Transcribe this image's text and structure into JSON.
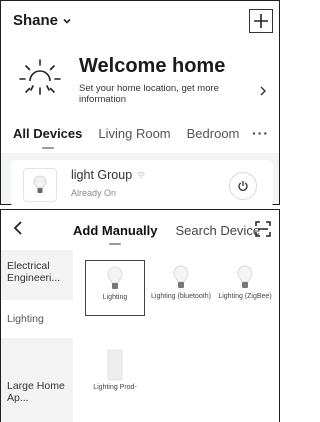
{
  "top": {
    "home_name": "Shane",
    "welcome_title": "Welcome home",
    "welcome_subtitle": "Set your home location, get more information",
    "rooms": [
      "All Devices",
      "Living Room",
      "Bedroom"
    ],
    "more_label": "···",
    "device": {
      "name": "light Group",
      "status": "Already On"
    }
  },
  "bottom": {
    "tabs": [
      "Add Manually",
      "Search Device"
    ],
    "categories": [
      "Electrical Engineeri...",
      "Lighting",
      "Large Home Ap..."
    ],
    "products": [
      {
        "label": "Lighting"
      },
      {
        "label": "Lighting (bluetooth)"
      },
      {
        "label": "Lighting (ZigBee)"
      },
      {
        "label": "Lighting Prod-"
      }
    ]
  }
}
